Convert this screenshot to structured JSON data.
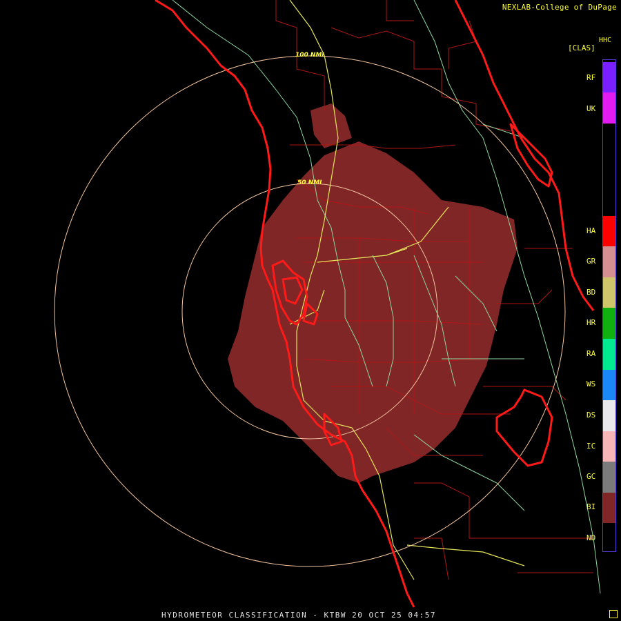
{
  "credit": "NEXLAB-College of DuPage",
  "product_code": "HHC",
  "units_label": "[CLAS]",
  "footer_title": "HYDROMETEOR CLASSIFICATION - KTBW 20 OCT 25 04:57",
  "range_rings": [
    {
      "label": "100 NMI"
    },
    {
      "label": "50 NMI"
    }
  ],
  "legend": [
    {
      "code": "RF",
      "color": "#7a1fff"
    },
    {
      "code": "UK",
      "color": "#e21bf0"
    },
    {
      "code": "HA",
      "color": "#ff0000"
    },
    {
      "code": "GR",
      "color": "#d49090"
    },
    {
      "code": "BD",
      "color": "#cfc56a"
    },
    {
      "code": "HR",
      "color": "#10b010"
    },
    {
      "code": "RA",
      "color": "#00e890"
    },
    {
      "code": "WS",
      "color": "#1b88f7"
    },
    {
      "code": "DS",
      "color": "#e8e8ec"
    },
    {
      "code": "IC",
      "color": "#f7b6b6"
    },
    {
      "code": "GC",
      "color": "#7b7b7b"
    },
    {
      "code": "BI",
      "color": "#802626"
    },
    {
      "code": "ND",
      "color": "#000000"
    }
  ],
  "colors": {
    "coastline": "#ff1a1a",
    "county_lines": "#b01616",
    "highways_primary": "#e6e65a",
    "highways_secondary": "#8fd8a0",
    "range_rings": "#f3c6a0",
    "biological_echo": "#802626"
  }
}
